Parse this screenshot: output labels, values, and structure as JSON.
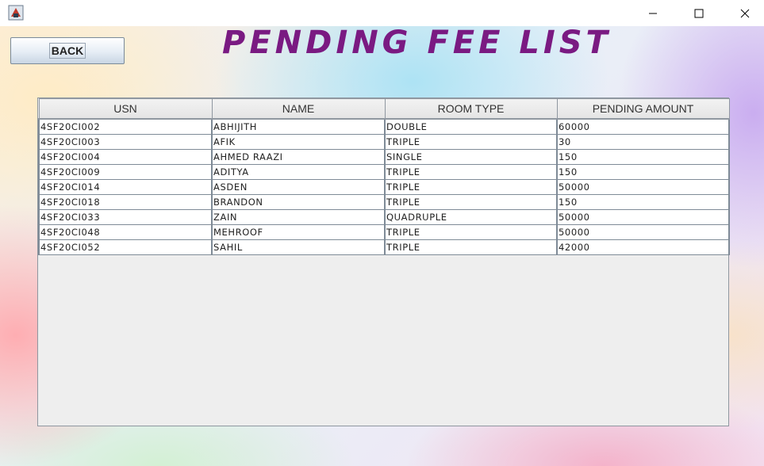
{
  "window": {
    "icon": "java-app-icon",
    "controls": [
      "minimize-icon",
      "maximize-icon",
      "close-icon"
    ]
  },
  "header": {
    "back_label": "BACK",
    "title": "PENDING FEE LIST"
  },
  "table": {
    "columns": [
      "USN",
      "NAME",
      "ROOM TYPE",
      "PENDING AMOUNT"
    ],
    "rows": [
      [
        "4SF20CI002",
        "ABHIJITH",
        "DOUBLE",
        "60000"
      ],
      [
        "4SF20CI003",
        "AFIK",
        "TRIPLE",
        "30"
      ],
      [
        "4SF20CI004",
        "AHMED RAAZI",
        "SINGLE",
        "150"
      ],
      [
        "4SF20CI009",
        "ADITYA",
        "TRIPLE",
        "150"
      ],
      [
        "4SF20CI014",
        "ASDEN",
        "TRIPLE",
        "50000"
      ],
      [
        "4SF20CI018",
        "BRANDON",
        "TRIPLE",
        "150"
      ],
      [
        "4SF20CI033",
        "ZAIN",
        "QUADRUPLE",
        "50000"
      ],
      [
        "4SF20CI048",
        "MEHROOF",
        "TRIPLE",
        "50000"
      ],
      [
        "4SF20CI052",
        "SAHIL",
        "TRIPLE",
        "42000"
      ]
    ]
  },
  "colors": {
    "title": "#7a1a82",
    "grid": "#7f8b97"
  }
}
